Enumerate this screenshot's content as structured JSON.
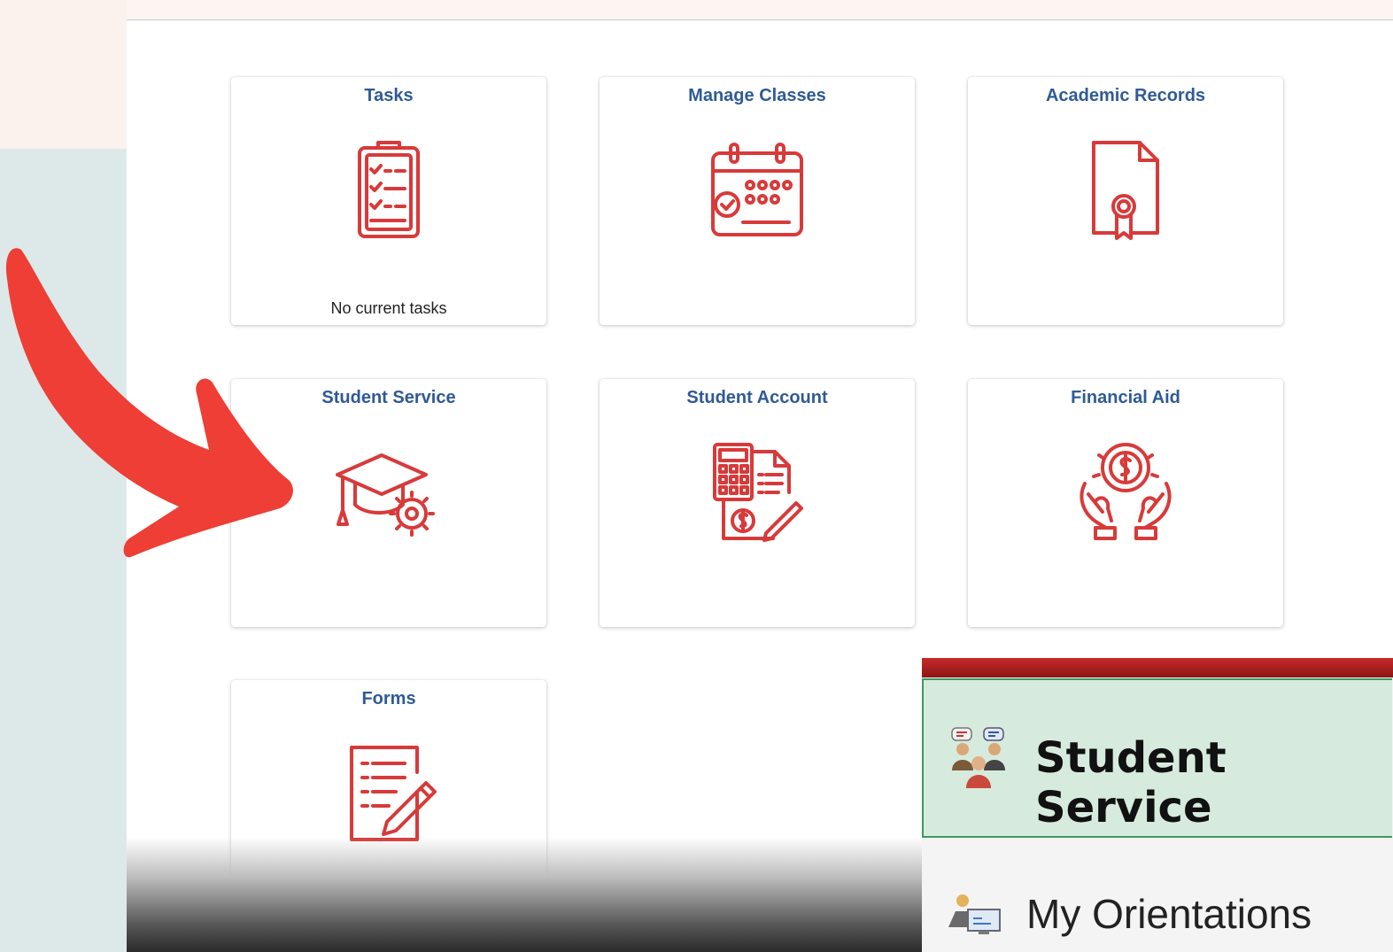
{
  "tiles": [
    {
      "title": "Tasks",
      "icon": "clipboard-checklist-icon",
      "footer": "No current tasks"
    },
    {
      "title": "Manage Classes",
      "icon": "calendar-check-icon"
    },
    {
      "title": "Academic Records",
      "icon": "certificate-document-icon"
    },
    {
      "title": "Student Service",
      "icon": "graduation-cap-gear-icon"
    },
    {
      "title": "Student Account",
      "icon": "calculator-invoice-icon"
    },
    {
      "title": "Financial Aid",
      "icon": "hands-coin-icon"
    },
    {
      "title": "Forms",
      "icon": "form-pencil-icon"
    }
  ],
  "inset": {
    "header_label": "Student Service",
    "header_icon": "people-chat-icon",
    "item_label": "My Orientations",
    "item_icon": "orientation-icon"
  },
  "colors": {
    "tile_title": "#2f5a96",
    "icon_red": "#d83a3a",
    "arrow": "#ee3e36",
    "inset_header_bg": "#d6ebdd",
    "inset_header_border": "#3d9a5a",
    "inset_topbar": "#b22222"
  }
}
